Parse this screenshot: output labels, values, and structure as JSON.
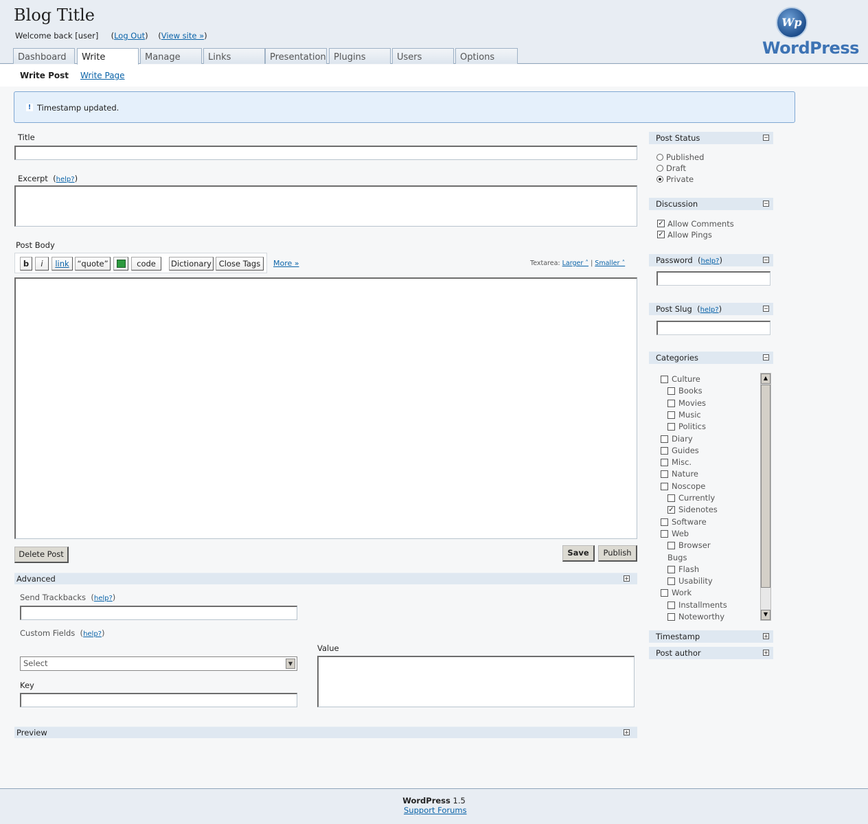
{
  "header": {
    "blog_title": "Blog Title",
    "welcome": "Welcome back [user]",
    "logout": "Log Out",
    "view_site": "View site »",
    "logo_text": "WordPress",
    "logo_mark": "Wp"
  },
  "tabs": [
    "Dashboard",
    "Write",
    "Manage",
    "Links",
    "Presentation",
    "Plugins",
    "Users",
    "Options"
  ],
  "active_tab": "Write",
  "subnav": {
    "current": "Write Post",
    "other": "Write Page"
  },
  "notice": {
    "icon": "!",
    "text": "Timestamp updated."
  },
  "form": {
    "title_label": "Title",
    "title_value": "",
    "excerpt_label": "Excerpt",
    "help": "help?",
    "excerpt_value": "",
    "body_label": "Post Body",
    "body_value": "",
    "quicktags": [
      "b",
      "i",
      "link",
      "“quote”",
      "code",
      "Dictionary",
      "Close Tags"
    ],
    "more": "More »",
    "textarea_label": "Textarea:",
    "larger": "Larger ˄",
    "smaller": "Smaller ˄",
    "delete_button": "Delete Post",
    "save_button": "Save",
    "publish_button": "Publish"
  },
  "advanced": {
    "title": "Advanced",
    "trackbacks_label": "Send Trackbacks",
    "custom_fields_label": "Custom Fields",
    "select_value": "Select",
    "key_label": "Key",
    "value_label": "Value"
  },
  "preview": {
    "title": "Preview"
  },
  "sidebar": {
    "post_status": {
      "title": "Post Status",
      "options": [
        {
          "label": "Published",
          "selected": false
        },
        {
          "label": "Draft",
          "selected": false
        },
        {
          "label": "Private",
          "selected": true
        }
      ]
    },
    "discussion": {
      "title": "Discussion",
      "options": [
        {
          "label": "Allow Comments",
          "checked": true
        },
        {
          "label": "Allow Pings",
          "checked": true
        }
      ]
    },
    "password": {
      "title": "Password",
      "help": "help?",
      "value": ""
    },
    "post_slug": {
      "title": "Post Slug",
      "help": "help?",
      "value": ""
    },
    "categories": {
      "title": "Categories",
      "items": [
        {
          "label": "Culture",
          "level": 0,
          "checked": false,
          "has_box": true
        },
        {
          "label": "Books",
          "level": 1,
          "checked": false,
          "has_box": true
        },
        {
          "label": "Movies",
          "level": 1,
          "checked": false,
          "has_box": true
        },
        {
          "label": "Music",
          "level": 1,
          "checked": false,
          "has_box": true
        },
        {
          "label": "Politics",
          "level": 1,
          "checked": false,
          "has_box": true
        },
        {
          "label": "Diary",
          "level": 0,
          "checked": false,
          "has_box": true
        },
        {
          "label": "Guides",
          "level": 0,
          "checked": false,
          "has_box": true
        },
        {
          "label": "Misc.",
          "level": 0,
          "checked": false,
          "has_box": true
        },
        {
          "label": "Nature",
          "level": 0,
          "checked": false,
          "has_box": true
        },
        {
          "label": "Noscope",
          "level": 0,
          "checked": false,
          "has_box": true
        },
        {
          "label": "Currently",
          "level": 1,
          "checked": false,
          "has_box": true
        },
        {
          "label": "Sidenotes",
          "level": 1,
          "checked": true,
          "has_box": true
        },
        {
          "label": "Software",
          "level": 0,
          "checked": false,
          "has_box": true
        },
        {
          "label": "Web",
          "level": 0,
          "checked": false,
          "has_box": true
        },
        {
          "label": "Browser",
          "level": 1,
          "checked": false,
          "has_box": true
        },
        {
          "label": "Bugs",
          "level": 1,
          "checked": false,
          "has_box": false
        },
        {
          "label": "Flash",
          "level": 1,
          "checked": false,
          "has_box": true
        },
        {
          "label": "Usability",
          "level": 1,
          "checked": false,
          "has_box": true
        },
        {
          "label": "Work",
          "level": 0,
          "checked": false,
          "has_box": true
        },
        {
          "label": "Installments",
          "level": 1,
          "checked": false,
          "has_box": true
        },
        {
          "label": "Noteworthy",
          "level": 1,
          "checked": false,
          "has_box": true
        }
      ]
    },
    "timestamp": {
      "title": "Timestamp"
    },
    "post_author": {
      "title": "Post author"
    }
  },
  "footer": {
    "version_name": "WordPress",
    "version": "1.5",
    "support": "Support Forums"
  }
}
